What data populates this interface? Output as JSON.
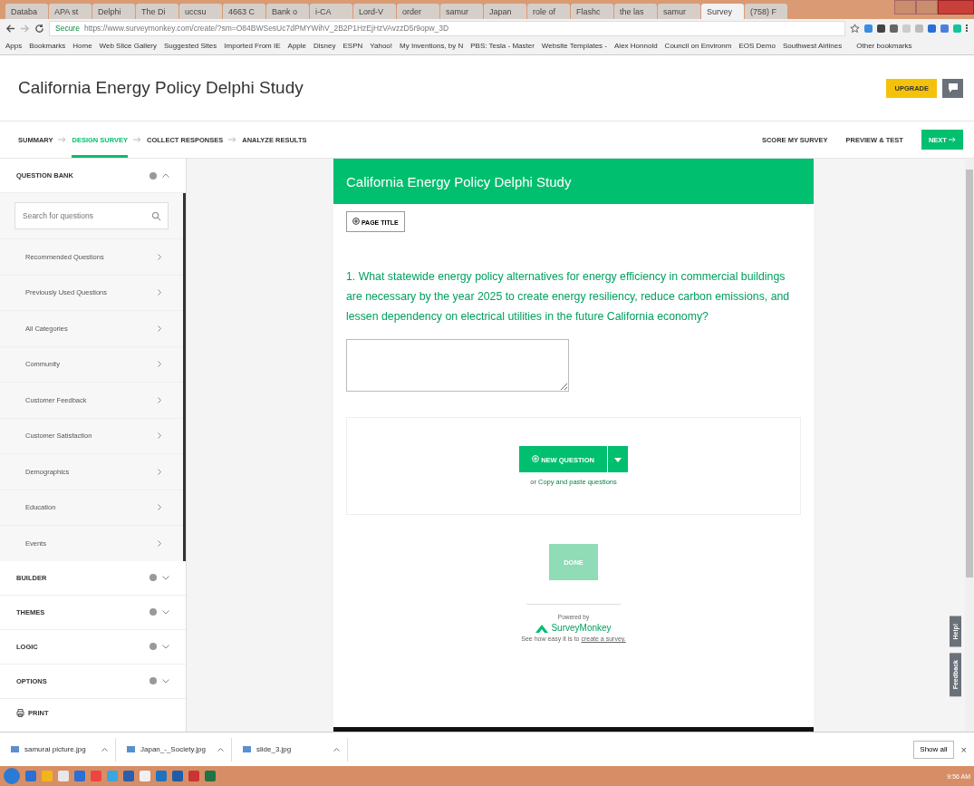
{
  "browser": {
    "tabs": [
      {
        "label": "Databa",
        "selected": false
      },
      {
        "label": "APA st",
        "selected": false
      },
      {
        "label": "Delphi",
        "selected": false
      },
      {
        "label": "The Di",
        "selected": false
      },
      {
        "label": "uccsu",
        "selected": false
      },
      {
        "label": "4663 C",
        "selected": false
      },
      {
        "label": "Bank o",
        "selected": false
      },
      {
        "label": "i-CA",
        "selected": false
      },
      {
        "label": "Lord-V",
        "selected": false
      },
      {
        "label": "order",
        "selected": false
      },
      {
        "label": "samur",
        "selected": false
      },
      {
        "label": "Japan",
        "selected": false
      },
      {
        "label": "role of",
        "selected": false
      },
      {
        "label": "Flashc",
        "selected": false
      },
      {
        "label": "the las",
        "selected": false
      },
      {
        "label": "samur",
        "selected": false
      },
      {
        "label": "Survey",
        "selected": true
      },
      {
        "label": "(758) F",
        "selected": false
      }
    ],
    "secure_label": "Secure",
    "url": "https://www.surveymonkey.com/create/?sm=O84BWSesUc7dPMYWihV_2B2P1HzEjHzVAvzzD5r9opw_3D",
    "bookmarks": [
      "Apps",
      "Bookmarks",
      "Home",
      "Web Slice Gallery",
      "Suggested Sites",
      "Imported From IE",
      "Apple",
      "Disney",
      "ESPN",
      "Yahoo!",
      "My Inventions, by N",
      "PBS: Tesla - Master",
      "Website Templates -",
      "Alex Honnold",
      "Council on Environm",
      "EOS Demo",
      "Southwest Airlines"
    ],
    "other_bookmarks": "Other bookmarks"
  },
  "header": {
    "title": "California Energy Policy Delphi Study",
    "upgrade": "UPGRADE"
  },
  "nav": {
    "steps": [
      {
        "label": "SUMMARY",
        "selected": false
      },
      {
        "label": "DESIGN SURVEY",
        "selected": true
      },
      {
        "label": "COLLECT RESPONSES",
        "selected": false
      },
      {
        "label": "ANALYZE RESULTS",
        "selected": false
      }
    ],
    "actions": [
      "SCORE MY SURVEY",
      "PREVIEW & TEST"
    ],
    "next": "NEXT"
  },
  "sidebar": {
    "sections": [
      {
        "title": "QUESTION BANK",
        "expanded": true,
        "search_placeholder": "Search for questions",
        "items": [
          "Recommended Questions",
          "Previously Used Questions",
          "All Categories",
          "Community",
          "Customer Feedback",
          "Customer Satisfaction",
          "Demographics",
          "Education",
          "Events"
        ]
      },
      {
        "title": "BUILDER",
        "expanded": false
      },
      {
        "title": "THEMES",
        "expanded": false
      },
      {
        "title": "LOGIC",
        "expanded": false
      },
      {
        "title": "OPTIONS",
        "expanded": false
      }
    ],
    "print": "PRINT"
  },
  "survey": {
    "title": "California Energy Policy Delphi Study",
    "page_title_button": "PAGE TITLE",
    "question": "1. What statewide energy policy alternatives for energy efficiency in commercial buildings are necessary by the year 2025 to create energy resiliency, reduce carbon emissions, and lessen dependency on electrical utilities in the future California economy?",
    "new_question": "NEW QUESTION",
    "or_text": "or",
    "copy_link": "Copy and paste questions",
    "done": "DONE",
    "powered_by": "Powered by",
    "brand": "SurveyMonkey",
    "footer_text": "See how easy it is to",
    "footer_link": "create a survey."
  },
  "side_tabs": [
    "Help!",
    "Feedback"
  ],
  "downloads": {
    "files": [
      "samurai picture.jpg",
      "Japan_-_Society.jpg",
      "slide_3.jpg"
    ],
    "show_all": "Show all",
    "close": "×"
  },
  "taskbar": {
    "clock": "9:56 AM"
  }
}
